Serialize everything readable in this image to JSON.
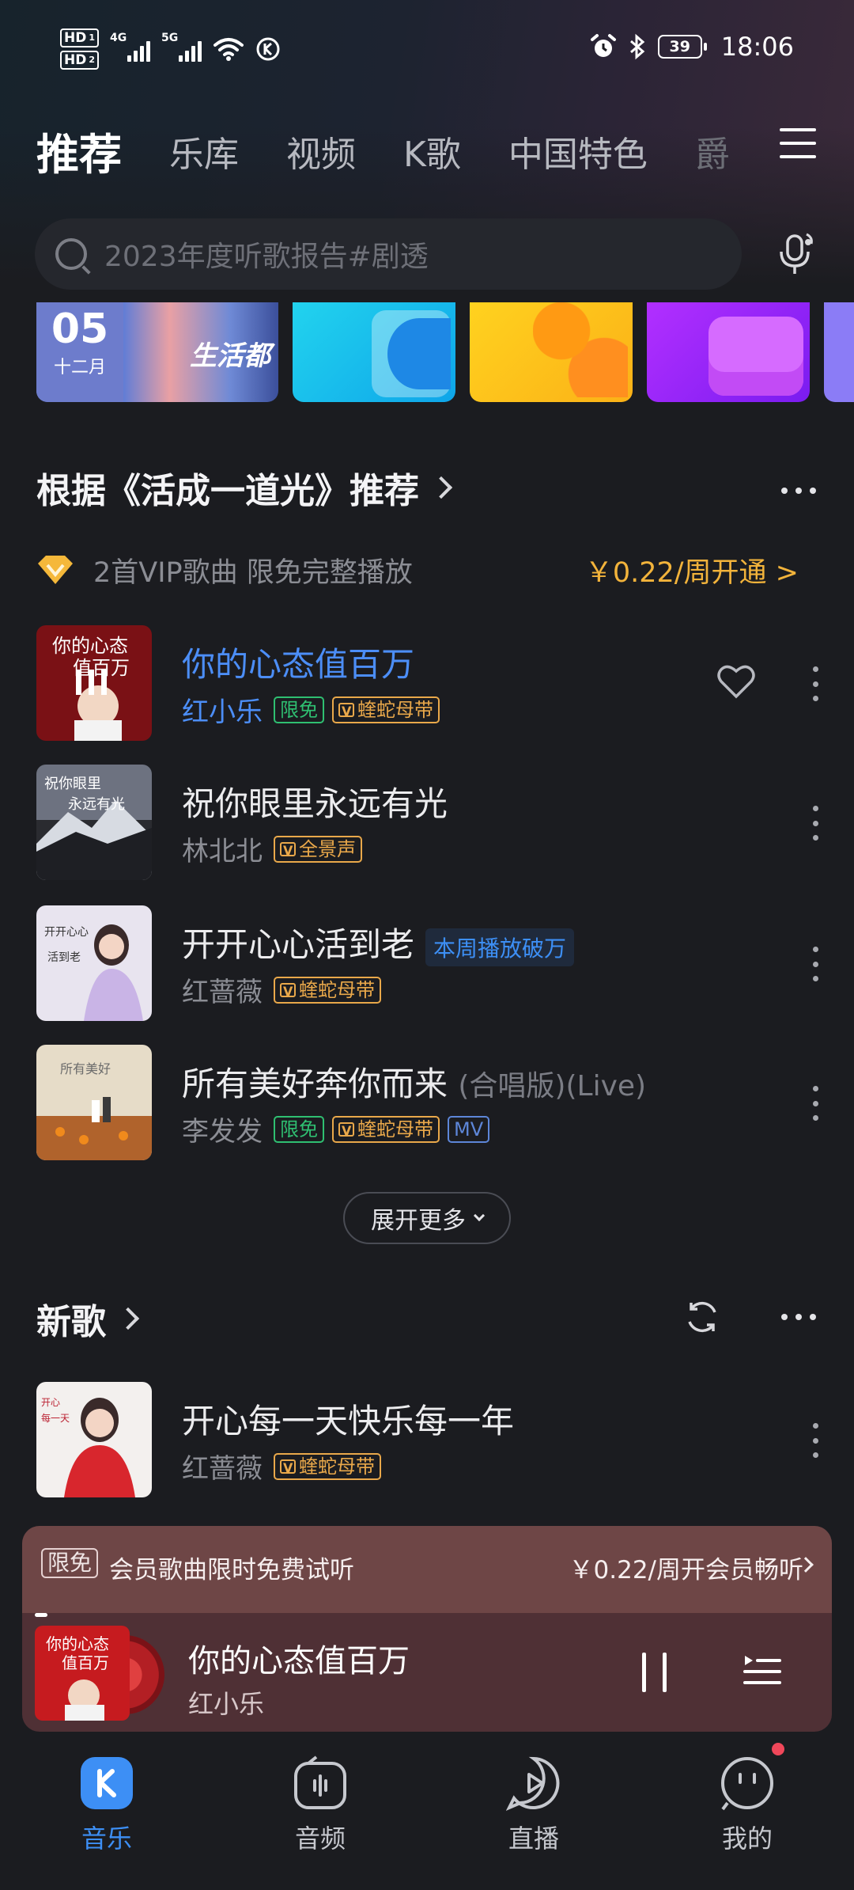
{
  "status_bar": {
    "hd1": "HD",
    "hd1_sub": "1",
    "hd2": "HD",
    "hd2_sub": "2",
    "gen1": "4G",
    "gen2": "5G",
    "battery": "39",
    "time": "18:06"
  },
  "tabs": [
    {
      "label": "推荐",
      "active": true
    },
    {
      "label": "乐库"
    },
    {
      "label": "视频"
    },
    {
      "label": "K歌"
    },
    {
      "label": "中国特色"
    },
    {
      "label": "爵"
    }
  ],
  "search": {
    "placeholder": "2023年度听歌报告#剧透"
  },
  "banner": {
    "day": "05",
    "month": "十二月",
    "caption": "生活都"
  },
  "recommend_section": {
    "title": "根据《活成一道光》推荐",
    "vip_text": "2首VIP歌曲 限免完整播放",
    "vip_price": "￥0.22/周开通 >"
  },
  "songs": [
    {
      "title": "你的心态值百万",
      "artist": "红小乐",
      "badges": [
        "限免",
        "蝰蛇母带"
      ],
      "playing": true
    },
    {
      "title": "祝你眼里永远有光",
      "artist": "林北北",
      "badges": [
        "全景声"
      ]
    },
    {
      "title": "开开心心活到老",
      "tag": "本周播放破万",
      "artist": "红蔷薇",
      "badges": [
        "蝰蛇母带"
      ]
    },
    {
      "title": "所有美好奔你而来",
      "title_sub": "(合唱版)(Live)",
      "artist": "李发发",
      "badges": [
        "限免",
        "蝰蛇母带",
        "MV"
      ]
    }
  ],
  "expand_label": "展开更多",
  "new_section": {
    "title": "新歌",
    "song": {
      "title": "开心每一天快乐每一年",
      "artist": "红蔷薇",
      "badge": "蝰蛇母带"
    }
  },
  "promo": {
    "tag": "限免",
    "text": "会员歌曲限时免费试听",
    "price": "￥0.22/周开会员畅听"
  },
  "player": {
    "title": "你的心态值百万",
    "artist": "红小乐"
  },
  "bottom_nav": [
    {
      "label": "音乐",
      "active": true
    },
    {
      "label": "音频"
    },
    {
      "label": "直播"
    },
    {
      "label": "我的"
    }
  ],
  "colors": {
    "accent": "#3d8ff5",
    "vip_gold": "#f2b33b",
    "free_green": "#2fbf71"
  }
}
